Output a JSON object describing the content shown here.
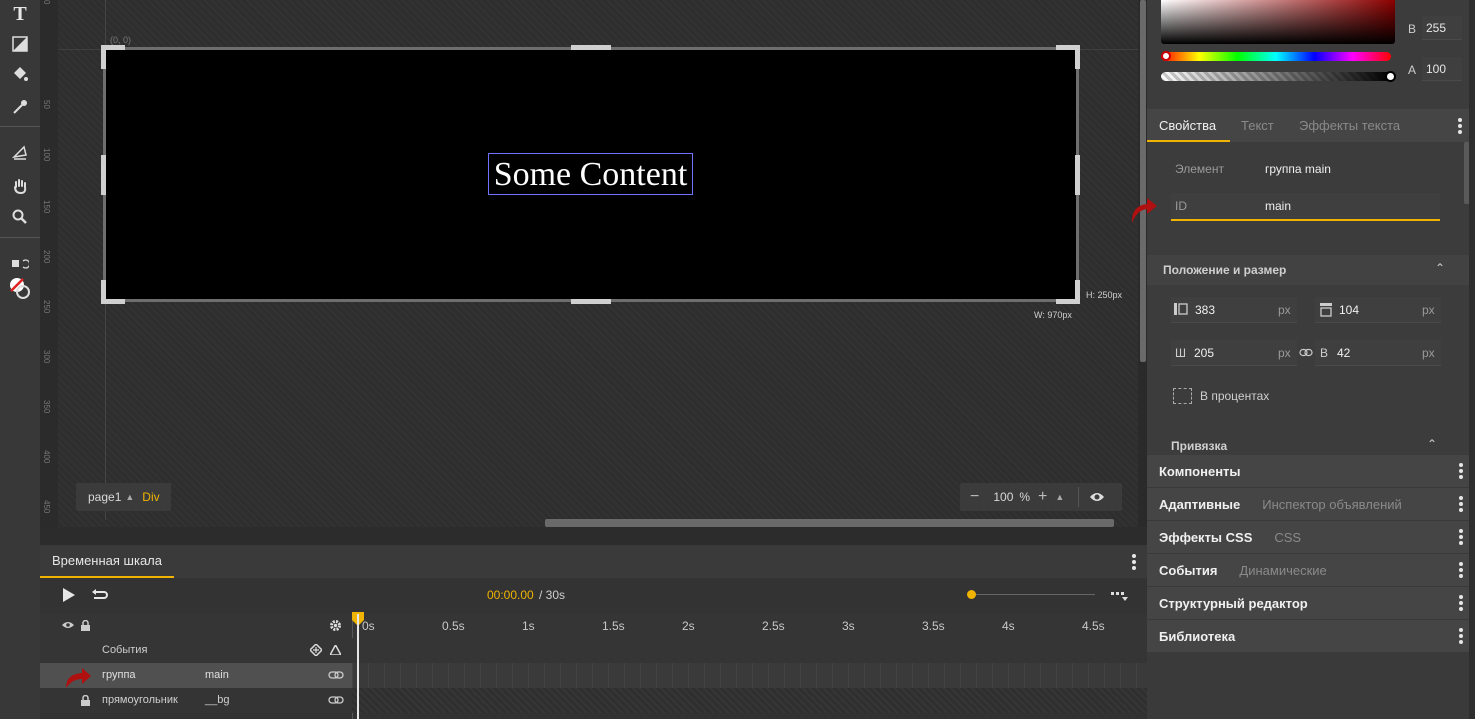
{
  "canvas": {
    "origin_label": "(0, 0)",
    "ruler_ticks": [
      "0",
      "50",
      "100",
      "150",
      "200",
      "250",
      "300",
      "350",
      "400",
      "450"
    ],
    "content_text": "Some Content",
    "height_label": "H: 250px",
    "width_label": "W: 970px",
    "page_selector": "page1",
    "element_type": "Div",
    "zoom": "100",
    "zoom_unit": "%"
  },
  "toolbar": {
    "icons": [
      "text-icon",
      "gradient-icon",
      "paint-bucket-icon",
      "eyedropper-icon",
      "transform-icon",
      "hand-icon",
      "zoom-icon",
      "swap-colors-icon",
      "no-fill-icon"
    ]
  },
  "timeline": {
    "tab_label": "Временная шкала",
    "time_current": "00:00.00",
    "time_total": "/ 30s",
    "ticks": [
      "0s",
      "0.5s",
      "1s",
      "1.5s",
      "2s",
      "2.5s",
      "3s",
      "3.5s",
      "4s",
      "4.5s"
    ],
    "rows": [
      {
        "label": "События",
        "name": ""
      },
      {
        "label": "группа",
        "name": "main"
      },
      {
        "label": "прямоугольник",
        "name": "__bg"
      }
    ]
  },
  "color_picker": {
    "b_label": "B",
    "b_value": "255",
    "a_label": "A",
    "a_value": "100",
    "colors": {
      "accent": "#f0b400"
    }
  },
  "properties": {
    "tabs": [
      "Свойства",
      "Текст",
      "Эффекты текста"
    ],
    "element_label": "Элемент",
    "element_value": "группа main",
    "id_label": "ID",
    "id_value": "main",
    "position_section": "Положение и размер",
    "x_value": "383",
    "y_value": "104",
    "w_label": "Ш",
    "w_value": "205",
    "h_label": "В",
    "h_value": "42",
    "unit": "px",
    "percent_label": "В процентах",
    "binding_section": "Привязка"
  },
  "sections": [
    {
      "primary": "Компоненты",
      "secondary": ""
    },
    {
      "primary": "Адаптивные",
      "secondary": "Инспектор объявлений"
    },
    {
      "primary": "Эффекты CSS",
      "secondary": "CSS"
    },
    {
      "primary": "События",
      "secondary": "Динамические"
    },
    {
      "primary": "Структурный редактор",
      "secondary": ""
    },
    {
      "primary": "Библиотека",
      "secondary": ""
    }
  ]
}
